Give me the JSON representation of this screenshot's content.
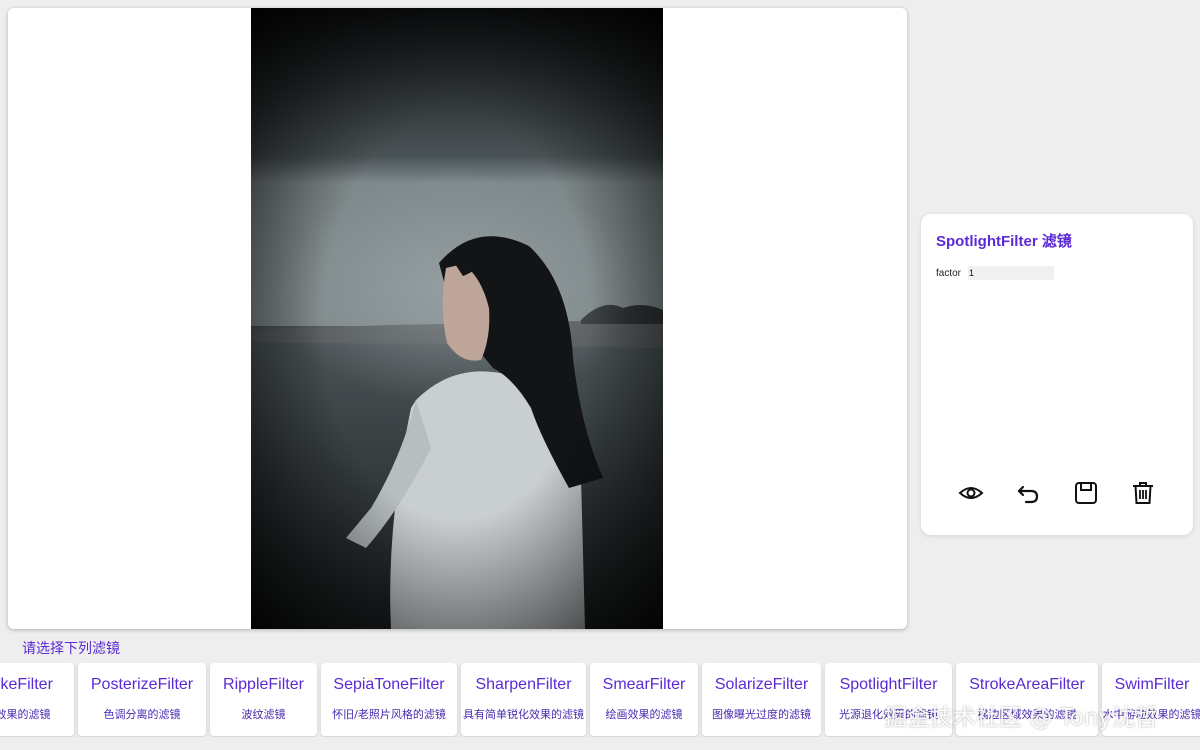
{
  "panel": {
    "title": "SpotlightFilter 滤镜",
    "params": [
      {
        "label": "factor",
        "value": "1"
      }
    ],
    "actions": [
      "eye-icon",
      "undo-icon",
      "save-icon",
      "trash-icon"
    ]
  },
  "filter_section": {
    "label": "请选择下列滤镜",
    "filters": [
      {
        "name": "StrokeFilter",
        "desc": "描边效果的滤镜"
      },
      {
        "name": "PosterizeFilter",
        "desc": "色调分离的滤镜"
      },
      {
        "name": "RippleFilter",
        "desc": "波纹滤镜"
      },
      {
        "name": "SepiaToneFilter",
        "desc": "怀旧/老照片风格的滤镜"
      },
      {
        "name": "SharpenFilter",
        "desc": "具有简单锐化效果的滤镜"
      },
      {
        "name": "SmearFilter",
        "desc": "绘画效果的滤镜"
      },
      {
        "name": "SolarizeFilter",
        "desc": "图像曝光过度的滤镜"
      },
      {
        "name": "SpotlightFilter",
        "desc": "光源退化效果的滤镜"
      },
      {
        "name": "StrokeAreaFilter",
        "desc": "描边区域效果的滤镜"
      },
      {
        "name": "SwimFilter",
        "desc": "水中游动效果的滤镜"
      }
    ]
  },
  "watermark": "掘金技术社区 @ Tony沈哲",
  "colors": {
    "accent": "#5b2ad6",
    "background": "#eeeeee"
  }
}
